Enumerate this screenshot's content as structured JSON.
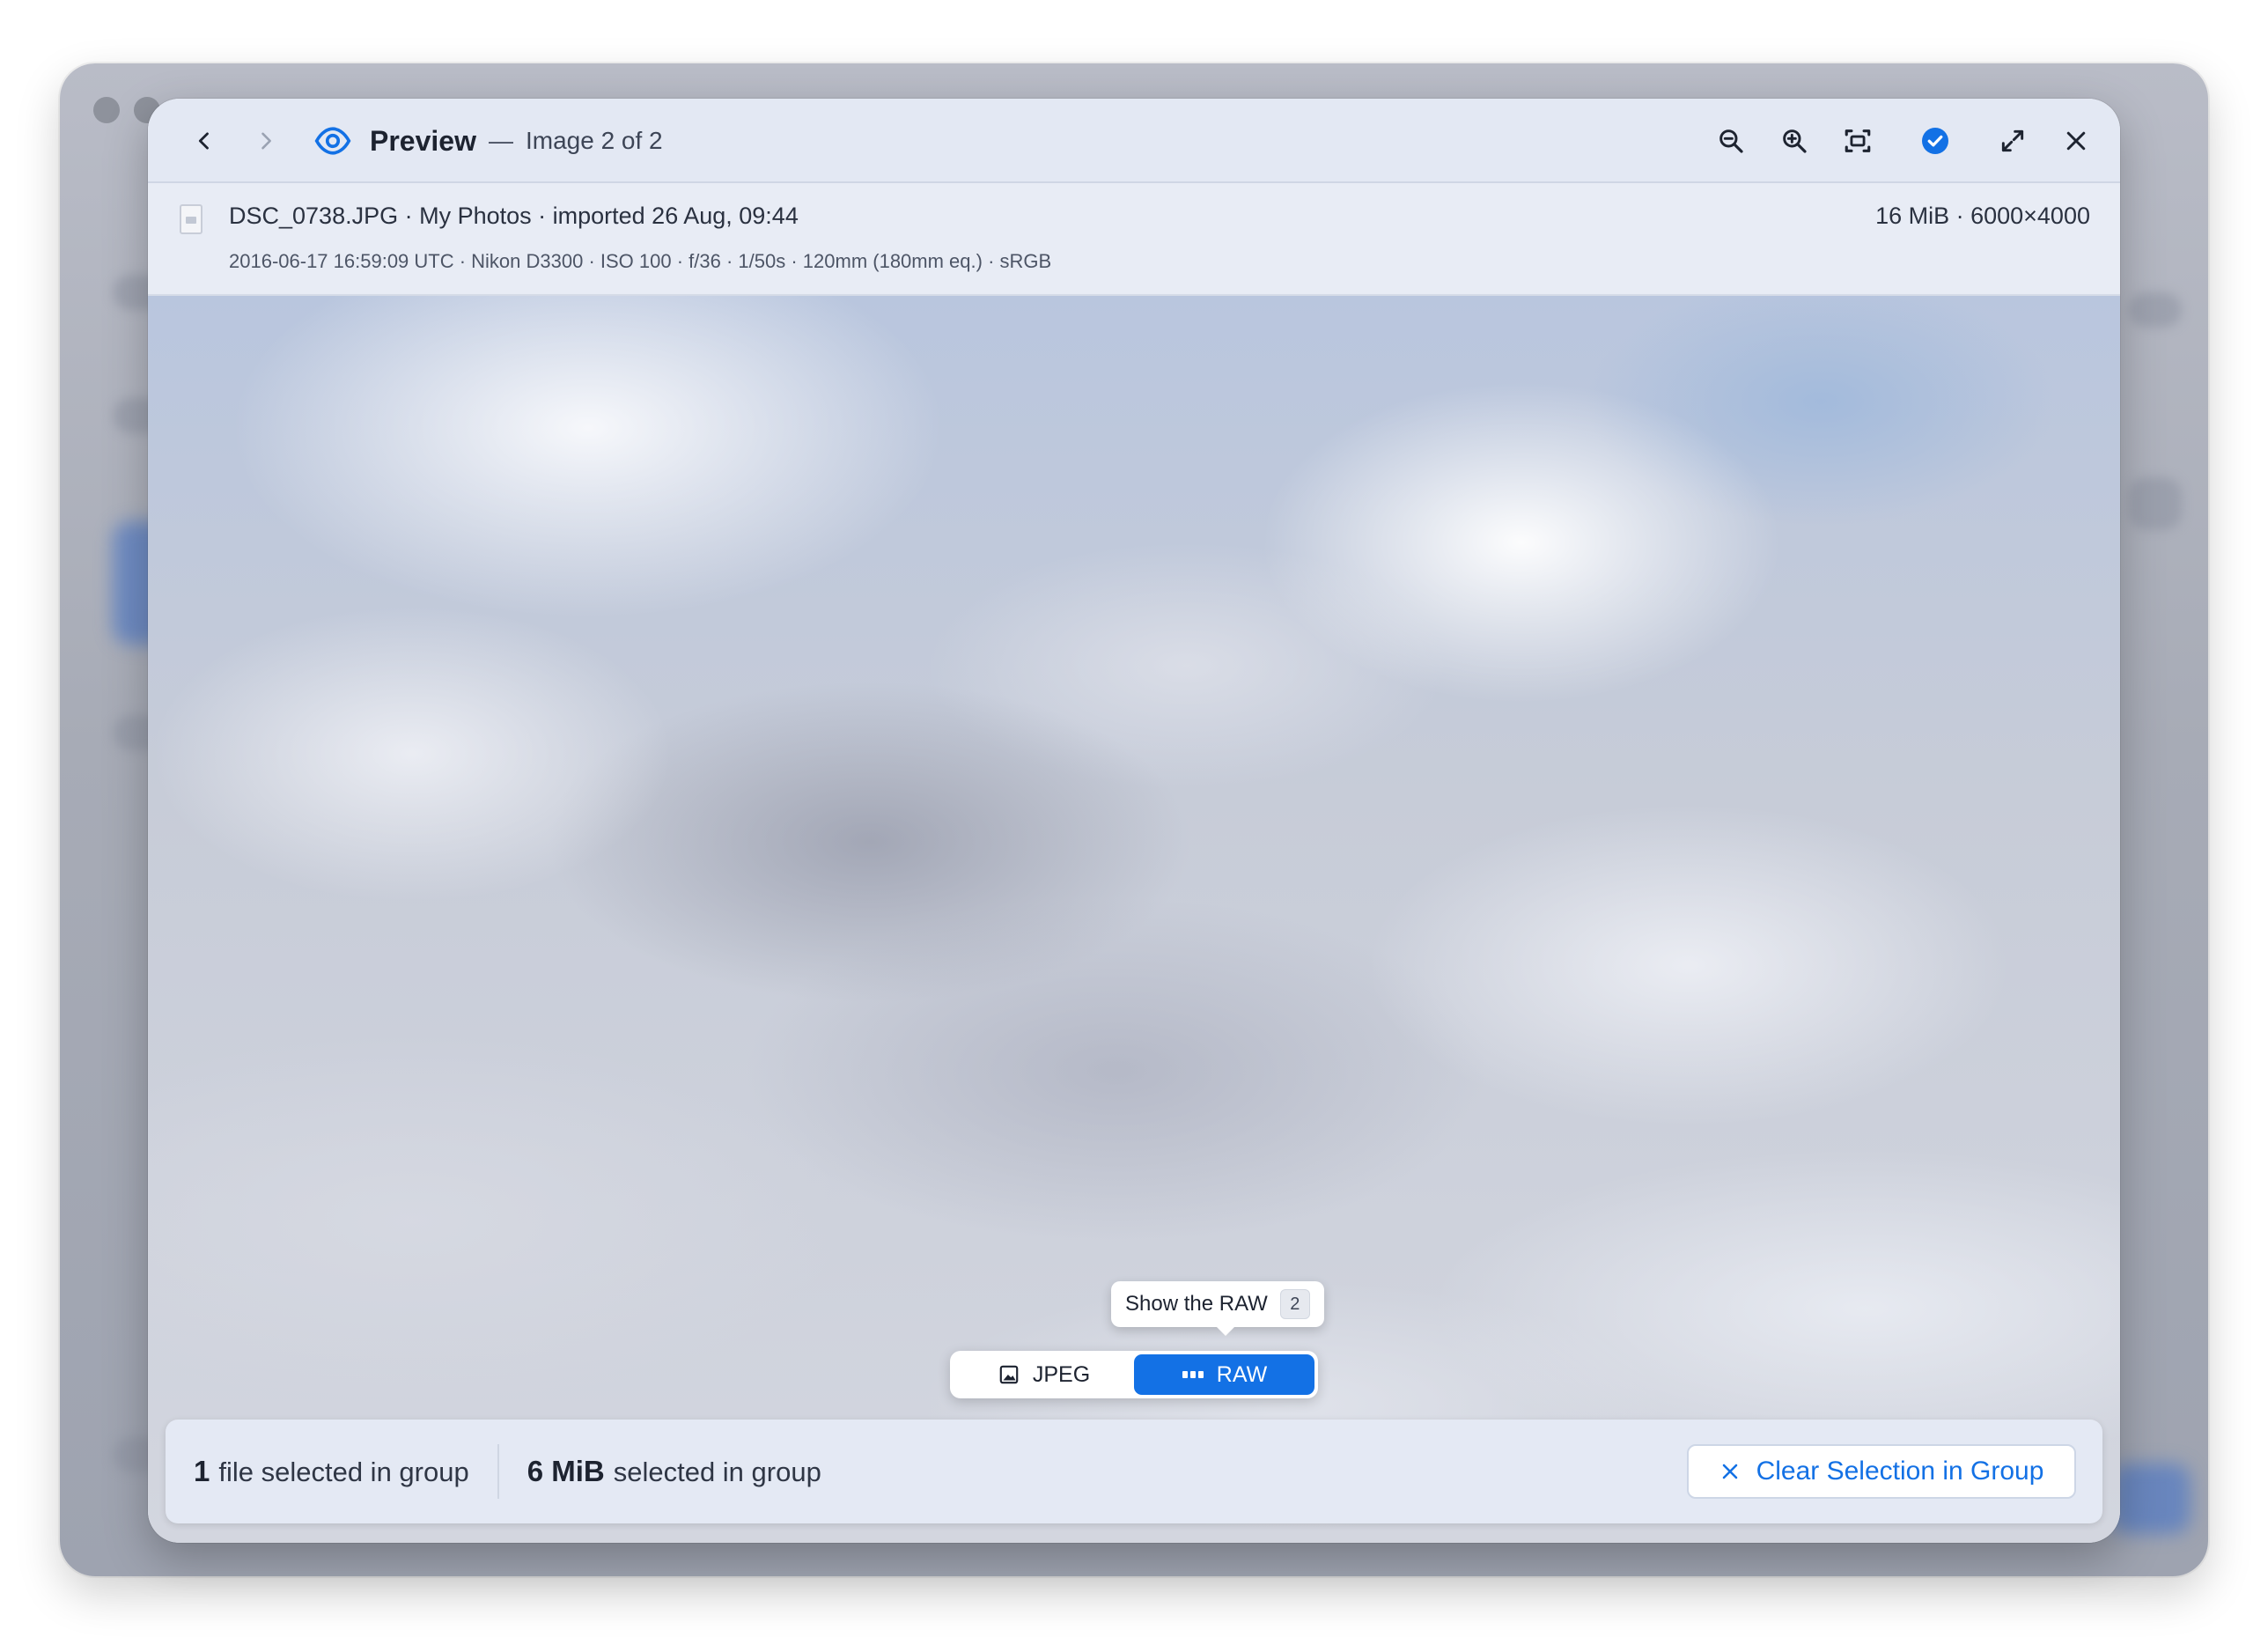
{
  "colors": {
    "accent": "#1371e5",
    "header_bg": "#e3e8f3"
  },
  "header": {
    "title": "Preview",
    "separator": "—",
    "subtitle": "Image 2 of 2"
  },
  "file": {
    "summary": "DSC_0738.JPG · My Photos · imported 26 Aug, 09:44",
    "size_dims": "16 MiB · 6000×4000",
    "meta": "2016-06-17 16:59:09 UTC · Nikon D3300 · ISO 100 · f/36 · 1/50s · 120mm (180mm eq.) · sRGB"
  },
  "toggle": {
    "tooltip": "Show the RAW",
    "shortcut": "2",
    "options": [
      {
        "label": "JPEG",
        "icon": "image-icon",
        "active": false
      },
      {
        "label": "RAW",
        "icon": "raw-icon",
        "active": true
      }
    ]
  },
  "selection": {
    "count": "1",
    "count_label": "file selected in group",
    "size": "6 MiB",
    "size_label": "selected in group",
    "clear_label": "Clear Selection in Group"
  },
  "icons": [
    "chevron-left-icon",
    "chevron-right-icon",
    "eye-icon",
    "zoom-out-icon",
    "zoom-in-icon",
    "fit-screen-icon",
    "check-circle-icon",
    "expand-icon",
    "close-icon",
    "file-icon",
    "image-icon",
    "raw-icon"
  ]
}
